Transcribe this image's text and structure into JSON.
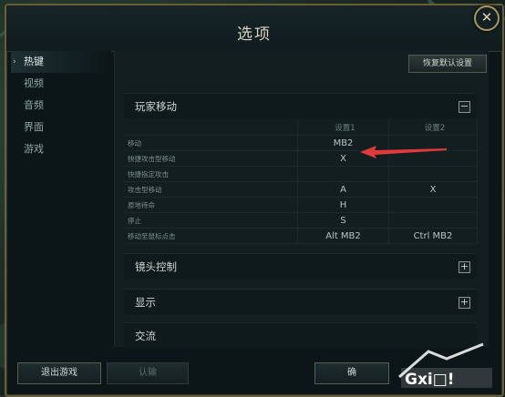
{
  "dialog": {
    "title": "选项",
    "close_glyph": "✕"
  },
  "sidebar": {
    "items": [
      {
        "label": "热键",
        "active": true
      },
      {
        "label": "视频",
        "active": false
      },
      {
        "label": "音频",
        "active": false
      },
      {
        "label": "界面",
        "active": false
      },
      {
        "label": "游戏",
        "active": false
      }
    ]
  },
  "content": {
    "restore_defaults": "恢复默认设置",
    "sections": [
      {
        "title": "玩家移动",
        "toggle": "−"
      },
      {
        "title": "镜头控制",
        "toggle": "+"
      },
      {
        "title": "显示",
        "toggle": "+"
      },
      {
        "title": "交流",
        "toggle": ""
      }
    ],
    "table": {
      "headers": [
        "",
        "设置1",
        "设置2"
      ],
      "rows": [
        {
          "action": "移动",
          "key1": "MB2",
          "key2": ""
        },
        {
          "action": "快捷攻击型移动",
          "key1": "X",
          "key2": ""
        },
        {
          "action": "快捷指定攻击",
          "key1": "",
          "key2": ""
        },
        {
          "action": "攻击型移动",
          "key1": "A",
          "key2": "X"
        },
        {
          "action": "原地待命",
          "key1": "H",
          "key2": ""
        },
        {
          "action": "停止",
          "key1": "S",
          "key2": ""
        },
        {
          "action": "移动至鼠标点击",
          "key1": "Alt MB2",
          "key2": "Ctrl MB2"
        }
      ]
    }
  },
  "footer": {
    "exit_game": "退出游戏",
    "confirm": "认输",
    "ok": "确"
  },
  "colors": {
    "accent_red": "#e03a3a",
    "gold_border": "#6b5d3a"
  }
}
